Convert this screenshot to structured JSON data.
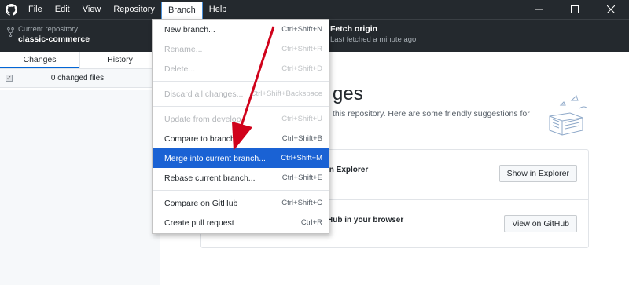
{
  "menubar": {
    "items": [
      "File",
      "Edit",
      "View",
      "Repository",
      "Branch",
      "Help"
    ],
    "active": "Branch"
  },
  "toolbar": {
    "repo_label": "Current repository",
    "repo_name": "classic-commerce",
    "fetch_title": "Fetch origin",
    "fetch_subtitle": "Last fetched a minute ago"
  },
  "sidebar": {
    "tabs": [
      "Changes",
      "History"
    ],
    "changed_files": "0 changed files"
  },
  "main": {
    "title_fragment": "ges",
    "subtitle_fragment": "this repository. Here are some friendly suggestions for",
    "cards": [
      {
        "text": "in Explorer",
        "button": "Show in Explorer"
      },
      {
        "text": "Hub in your browser",
        "button": "View on GitHub"
      }
    ]
  },
  "branch_menu": {
    "items": [
      {
        "label": "New branch...",
        "shortcut": "Ctrl+Shift+N",
        "state": "enabled"
      },
      {
        "label": "Rename...",
        "shortcut": "Ctrl+Shift+R",
        "state": "disabled"
      },
      {
        "label": "Delete...",
        "shortcut": "Ctrl+Shift+D",
        "state": "disabled"
      },
      {
        "sep": true
      },
      {
        "label": "Discard all changes...",
        "shortcut": "Ctrl+Shift+Backspace",
        "state": "disabled"
      },
      {
        "sep": true
      },
      {
        "label": "Update from develop",
        "shortcut": "Ctrl+Shift+U",
        "state": "disabled"
      },
      {
        "label": "Compare to branch",
        "shortcut": "Ctrl+Shift+B",
        "state": "enabled"
      },
      {
        "label": "Merge into current branch...",
        "shortcut": "Ctrl+Shift+M",
        "state": "highlight"
      },
      {
        "label": "Rebase current branch...",
        "shortcut": "Ctrl+Shift+E",
        "state": "enabled"
      },
      {
        "sep": true
      },
      {
        "label": "Compare on GitHub",
        "shortcut": "Ctrl+Shift+C",
        "state": "enabled"
      },
      {
        "label": "Create pull request",
        "shortcut": "Ctrl+R",
        "state": "enabled"
      }
    ]
  },
  "colors": {
    "dark_bar": "#24292e",
    "highlight": "#1a62d4",
    "arrow": "#d0021b"
  },
  "icons": [
    "github-logo-icon",
    "repo-fork-icon",
    "minimize-icon",
    "maximize-icon",
    "close-icon",
    "checkbox-icon",
    "callout-arrow"
  ]
}
